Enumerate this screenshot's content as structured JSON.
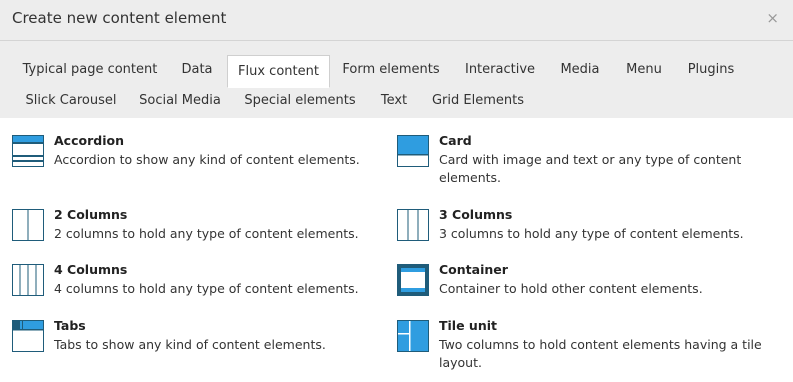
{
  "dialog": {
    "title": "Create new content element",
    "close_glyph": "×"
  },
  "tabs": [
    {
      "label": "Typical page content",
      "active": false
    },
    {
      "label": "Data",
      "active": false
    },
    {
      "label": "Flux content",
      "active": true
    },
    {
      "label": "Form elements",
      "active": false
    },
    {
      "label": "Interactive",
      "active": false
    },
    {
      "label": "Media",
      "active": false
    },
    {
      "label": "Menu",
      "active": false
    },
    {
      "label": "Plugins",
      "active": false
    },
    {
      "label": "Slick Carousel",
      "active": false
    },
    {
      "label": "Social Media",
      "active": false
    },
    {
      "label": "Special elements",
      "active": false
    },
    {
      "label": "Text",
      "active": false
    },
    {
      "label": "Grid Elements",
      "active": false
    }
  ],
  "elements": [
    {
      "name": "Accordion",
      "description": "Accordion to show any kind of content elements.",
      "icon": "accordion-icon"
    },
    {
      "name": "Card",
      "description": "Card with image and text or any type of content elements.",
      "icon": "card-icon"
    },
    {
      "name": "2 Columns",
      "description": "2 columns to hold any type of content elements.",
      "icon": "two-columns-icon"
    },
    {
      "name": "3 Columns",
      "description": "3 columns to hold any type of content elements.",
      "icon": "three-columns-icon"
    },
    {
      "name": "4 Columns",
      "description": "4 columns to hold any type of content elements.",
      "icon": "four-columns-icon"
    },
    {
      "name": "Container",
      "description": "Container to hold other content elements.",
      "icon": "container-icon"
    },
    {
      "name": "Tabs",
      "description": "Tabs to show any kind of content elements.",
      "icon": "tabs-icon"
    },
    {
      "name": "Tile unit",
      "description": "Two columns to hold content elements having a tile layout.",
      "icon": "tile-unit-icon"
    }
  ],
  "colors": {
    "icon_dark": "#1f5c7a",
    "icon_light": "#2f9de0",
    "header_bg": "#ededed"
  }
}
